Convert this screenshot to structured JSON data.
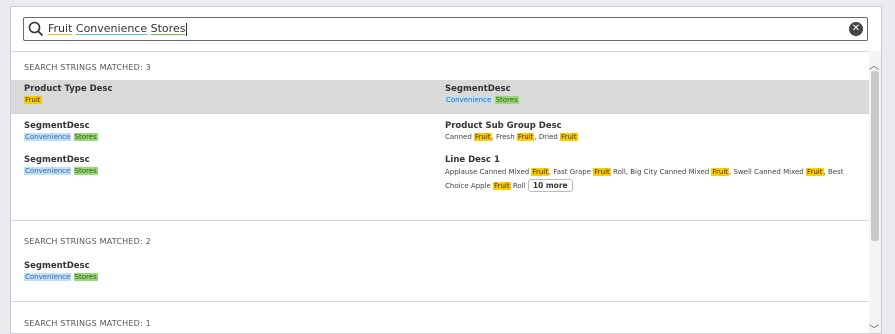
{
  "search": {
    "query": "Fruit Convenience Stores",
    "term1": "Fruit",
    "term2": "Convenience",
    "term3": "Stores"
  },
  "colors": {
    "yellow": "#ffcc00",
    "blue": "#bfe0fa",
    "green": "#9ad97a",
    "selected_band": "#d9d9d9"
  },
  "groups": [
    {
      "header": "SEARCH STRINGS MATCHED: 3",
      "items": [
        {
          "field": "Product Type Desc",
          "values": [
            "Fruit"
          ]
        },
        {
          "field": "SegmentDesc",
          "values": [
            "Convenience",
            "Stores"
          ]
        },
        {
          "field": "SegmentDesc",
          "values": [
            "Convenience",
            "Stores"
          ]
        },
        {
          "field": "Product Sub Group Desc",
          "v1a": "Canned ",
          "v1b": "Fruit",
          "sep1": ", Fresh ",
          "v2b": "Fruit",
          "sep2": ", Dried ",
          "v3b": "Fruit"
        },
        {
          "field": "SegmentDesc",
          "values": [
            "Convenience",
            "Stores"
          ]
        },
        {
          "field": "Line Desc 1",
          "p1": "Applause Canned Mixed ",
          "h1": "Fruit",
          "p2": ", Fast Grape ",
          "h2": "Fruit",
          "p3": " Roll, Big City Canned Mixed ",
          "h3": "Fruit",
          "p4": ", Swell Canned Mixed ",
          "h4": "Fruit",
          "p5": ", Best Choice Apple ",
          "h5": "Fruit",
          "p6": " Roll",
          "more": "10 more"
        }
      ]
    },
    {
      "header": "SEARCH STRINGS MATCHED: 2",
      "items": [
        {
          "field": "SegmentDesc",
          "values": [
            "Convenience",
            "Stores"
          ]
        }
      ]
    },
    {
      "header": "SEARCH STRINGS MATCHED: 1"
    }
  ]
}
